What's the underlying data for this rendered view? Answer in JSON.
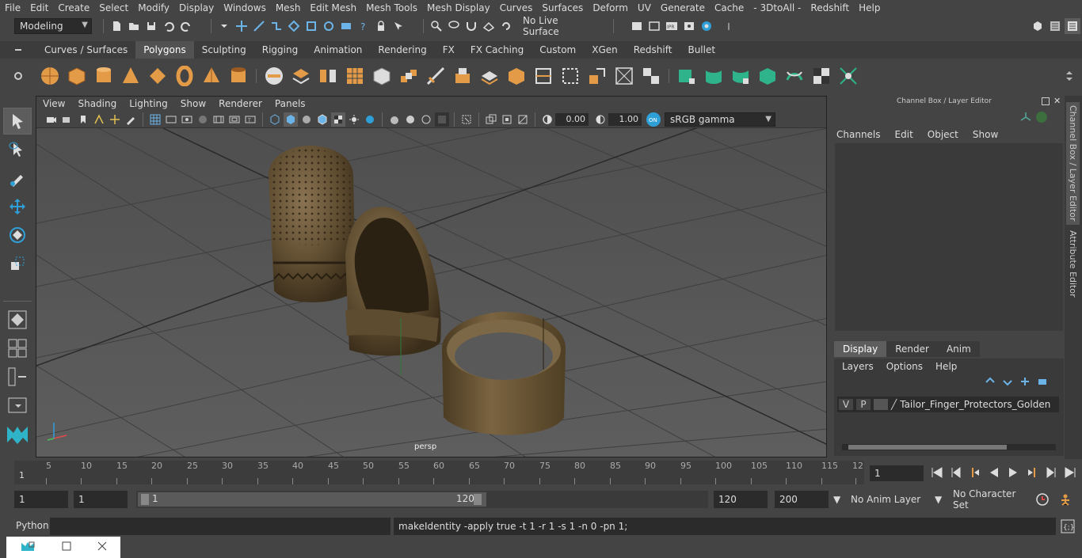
{
  "menubar": {
    "items": [
      "File",
      "Edit",
      "Create",
      "Select",
      "Modify",
      "Display",
      "Windows",
      "Mesh",
      "Edit Mesh",
      "Mesh Tools",
      "Mesh Display",
      "Curves",
      "Surfaces",
      "Deform",
      "UV",
      "Generate",
      "Cache",
      "- 3DtoAll -",
      "Redshift",
      "Help"
    ]
  },
  "statusline": {
    "mode": "Modeling",
    "live_surface": "No Live Surface"
  },
  "shelf": {
    "tabs": [
      "Curves / Surfaces",
      "Polygons",
      "Sculpting",
      "Rigging",
      "Animation",
      "Rendering",
      "FX",
      "FX Caching",
      "Custom",
      "XGen",
      "Redshift",
      "Bullet"
    ],
    "active_tab": "Polygons"
  },
  "viewport": {
    "menu": [
      "View",
      "Shading",
      "Lighting",
      "Show",
      "Renderer",
      "Panels"
    ],
    "exposure": "0.00",
    "gamma": "1.00",
    "colorspace": "sRGB gamma",
    "camera_label": "persp"
  },
  "channelbox": {
    "title": "Channel Box / Layer Editor",
    "menu": [
      "Channels",
      "Edit",
      "Object",
      "Show"
    ],
    "tabs": [
      "Display",
      "Render",
      "Anim"
    ],
    "active_tab": "Display",
    "layer_menu": [
      "Layers",
      "Options",
      "Help"
    ],
    "layer": {
      "v": "V",
      "p": "P",
      "name": "Tailor_Finger_Protectors_Golden_Set_"
    }
  },
  "sidetabs": {
    "channel": "Channel Box / Layer Editor",
    "attribute": "Attribute Editor"
  },
  "timeline": {
    "ticks": [
      "5",
      "10",
      "15",
      "20",
      "25",
      "30",
      "35",
      "40",
      "45",
      "50",
      "55",
      "60",
      "65",
      "70",
      "75",
      "80",
      "85",
      "90",
      "95",
      "100",
      "105",
      "110",
      "115",
      "12"
    ],
    "start_label": "1",
    "current_frame": "1"
  },
  "range": {
    "start": "1",
    "anim_start": "1",
    "range_start": "1",
    "range_end": "120",
    "end": "120",
    "anim_end": "200",
    "anim_layer": "No Anim Layer",
    "char_set": "No Character Set"
  },
  "cmdline": {
    "lang": "Python",
    "result": "makeIdentity -apply true -t 1 -r 1 -s 1 -n 0 -pn 1;"
  },
  "colors": {
    "accent": "#5285a6",
    "active_tab": "#525252",
    "shelf_orange": "#e39b47",
    "shelf_green": "#2fb38a"
  }
}
